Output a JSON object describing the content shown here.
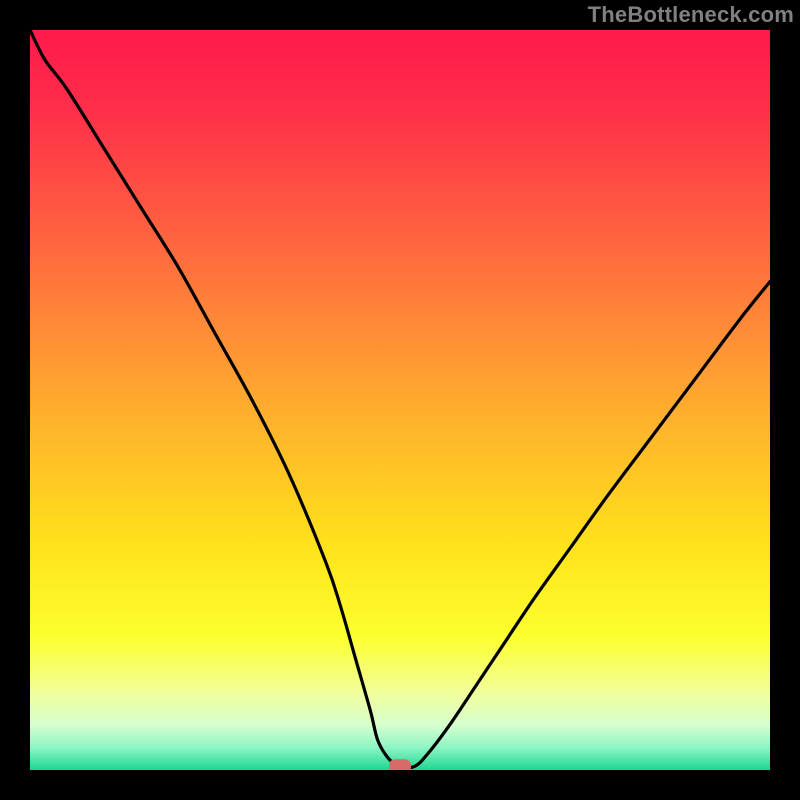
{
  "watermark": "TheBottleneck.com",
  "chart_data": {
    "type": "line",
    "title": "",
    "xlabel": "",
    "ylabel": "",
    "xlim": [
      0,
      100
    ],
    "ylim": [
      0,
      100
    ],
    "grid": false,
    "legend": false,
    "background_gradient_stops": [
      {
        "pct": 0.0,
        "color": "#ff1a4b"
      },
      {
        "pct": 0.1,
        "color": "#ff2c4a"
      },
      {
        "pct": 0.25,
        "color": "#ff5a42"
      },
      {
        "pct": 0.4,
        "color": "#ff8a37"
      },
      {
        "pct": 0.55,
        "color": "#ffb82a"
      },
      {
        "pct": 0.7,
        "color": "#ffe31a"
      },
      {
        "pct": 0.82,
        "color": "#fdff2e"
      },
      {
        "pct": 0.9,
        "color": "#f0ffa0"
      },
      {
        "pct": 0.94,
        "color": "#d4ffcf"
      },
      {
        "pct": 0.97,
        "color": "#8cf5c4"
      },
      {
        "pct": 1.0,
        "color": "#1bd890"
      }
    ],
    "series": [
      {
        "name": "bottleneck-curve",
        "color": "#000000",
        "x": [
          0,
          2,
          5,
          10,
          15,
          20,
          25,
          30,
          35,
          40,
          42,
          44,
          46,
          47,
          48.5,
          50,
          52,
          54,
          57,
          60,
          64,
          68,
          73,
          78,
          84,
          90,
          96,
          100
        ],
        "y": [
          100,
          96,
          92,
          84,
          76,
          68,
          59,
          50,
          40,
          28,
          22,
          15,
          8,
          4,
          1.5,
          0.5,
          0.5,
          2.5,
          6.5,
          11,
          17,
          23,
          30,
          37,
          45,
          53,
          61,
          66
        ]
      }
    ],
    "marker": {
      "x": 50,
      "y": 0.5,
      "shape": "rounded-rect",
      "color": "#d86a6a"
    }
  }
}
